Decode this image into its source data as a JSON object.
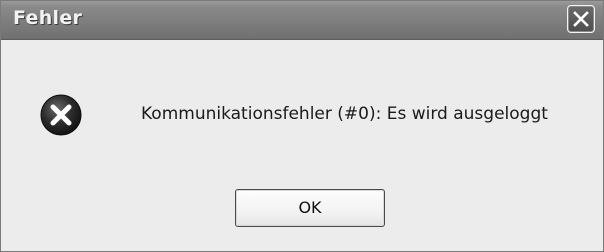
{
  "dialog": {
    "title": "Fehler",
    "message": "Kommunikationsfehler (#0): Es wird ausgeloggt",
    "ok_label": "OK",
    "icon": "error-icon",
    "close_icon": "close-icon"
  },
  "colors": {
    "titlebar": "#7c7c7c",
    "body": "#ececec",
    "icon": "#2a2a2a"
  }
}
